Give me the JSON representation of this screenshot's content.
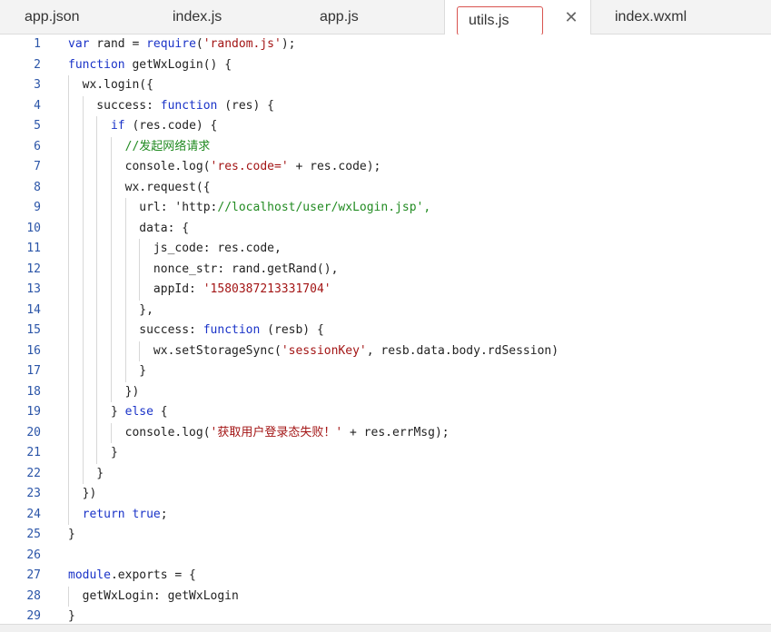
{
  "tabs": [
    {
      "label": "app.json"
    },
    {
      "label": "index.js"
    },
    {
      "label": "app.js"
    },
    {
      "label": "utils.js"
    },
    {
      "label": "index.wxml"
    }
  ],
  "close_glyph": "✕",
  "code_lines": [
    "var rand = require('random.js');",
    "function getWxLogin() {",
    "  wx.login({",
    "    success: function (res) {",
    "      if (res.code) {",
    "        //发起网络请求",
    "        console.log('res.code=' + res.code);",
    "        wx.request({",
    "          url: 'http://localhost/user/wxLogin.jsp',",
    "          data: {",
    "            js_code: res.code,",
    "            nonce_str: rand.getRand(),",
    "            appId: '1580387213331704'",
    "          },",
    "          success: function (resb) {",
    "            wx.setStorageSync('sessionKey', resb.data.body.rdSession)",
    "          }",
    "        })",
    "      } else {",
    "        console.log('获取用户登录态失败！' + res.errMsg);",
    "      }",
    "    }",
    "  })",
    "  return true;",
    "}",
    "",
    "module.exports = {",
    "  getWxLogin: getWxLogin",
    "}"
  ],
  "line_numbers": [
    "1",
    "2",
    "3",
    "4",
    "5",
    "6",
    "7",
    "8",
    "9",
    "10",
    "11",
    "12",
    "13",
    "14",
    "15",
    "16",
    "17",
    "18",
    "19",
    "20",
    "21",
    "22",
    "23",
    "24",
    "25",
    "26",
    "27",
    "28",
    "29"
  ],
  "colors": {
    "keyword": "#1a33c8",
    "string": "#a31515",
    "comment": "#228b22",
    "line_number": "#2b55a8",
    "active_tab_border": "#d9534f"
  }
}
